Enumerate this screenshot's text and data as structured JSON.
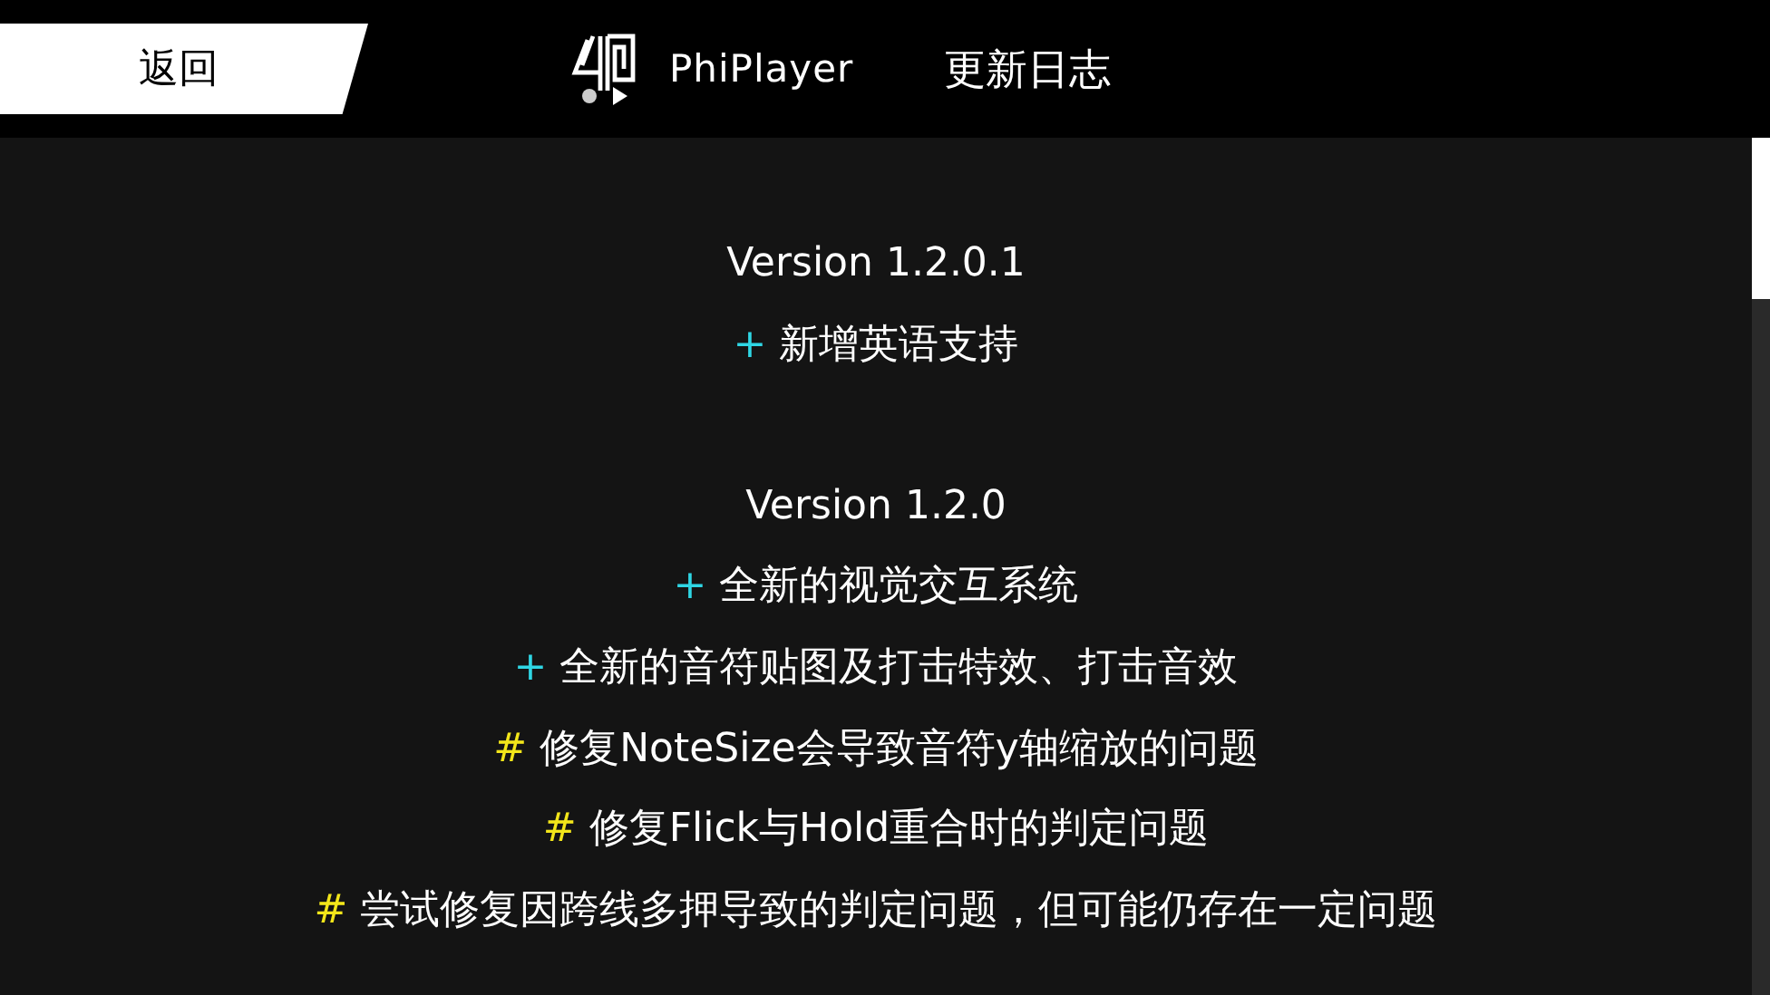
{
  "header": {
    "back_button": "返回",
    "app_name": "PhiPlayer",
    "page_title": "更新日志"
  },
  "changelog": [
    {
      "version": "Version 1.2.0.1",
      "changes": [
        {
          "kind": "add",
          "mark": "+",
          "text": "新增英语支持"
        }
      ]
    },
    {
      "version": "Version 1.2.0",
      "changes": [
        {
          "kind": "add",
          "mark": "+",
          "text": "全新的视觉交互系统"
        },
        {
          "kind": "add",
          "mark": "+",
          "text": "全新的音符贴图及打击特效、打击音效"
        },
        {
          "kind": "fix",
          "mark": "#",
          "text": "修复NoteSize会导致音符y轴缩放的问题"
        },
        {
          "kind": "fix",
          "mark": "#",
          "text": "修复Flick与Hold重合时的判定问题"
        },
        {
          "kind": "fix",
          "mark": "#",
          "text": "尝试修复因跨线多押导致的判定问题，但可能仍存在一定问题"
        }
      ]
    }
  ]
}
